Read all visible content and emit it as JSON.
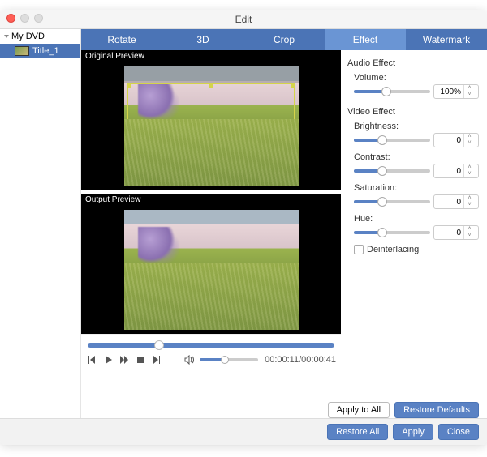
{
  "window": {
    "title": "Edit"
  },
  "sidebar": {
    "root_label": "My DVD",
    "items": [
      {
        "label": "Title_1"
      }
    ]
  },
  "tabs": [
    {
      "label": "Rotate",
      "active": false
    },
    {
      "label": "3D",
      "active": false
    },
    {
      "label": "Crop",
      "active": false
    },
    {
      "label": "Effect",
      "active": true
    },
    {
      "label": "Watermark",
      "active": false
    }
  ],
  "preview": {
    "original_label": "Original Preview",
    "output_label": "Output Preview"
  },
  "transport": {
    "seek_pct": 27,
    "volume_pct": 40,
    "time_current": "00:00:11",
    "time_total": "00:00:41"
  },
  "effects": {
    "audio_heading": "Audio Effect",
    "volume_label": "Volume:",
    "volume_value": "100%",
    "volume_pct": 40,
    "video_heading": "Video Effect",
    "brightness_label": "Brightness:",
    "brightness_value": "0",
    "brightness_pct": 35,
    "contrast_label": "Contrast:",
    "contrast_value": "0",
    "contrast_pct": 35,
    "saturation_label": "Saturation:",
    "saturation_value": "0",
    "saturation_pct": 35,
    "hue_label": "Hue:",
    "hue_value": "0",
    "hue_pct": 35,
    "deinterlace_label": "Deinterlacing"
  },
  "buttons": {
    "apply_all": "Apply to All",
    "restore_defaults": "Restore Defaults",
    "restore_all": "Restore All",
    "apply": "Apply",
    "close": "Close"
  }
}
